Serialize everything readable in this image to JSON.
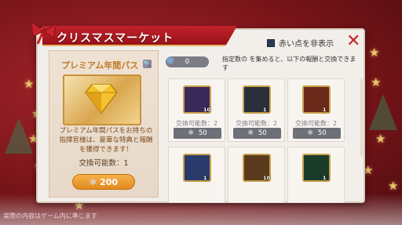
{
  "title": "クリスマスマーケット",
  "hide_red_dot_label": "赤い点を非表示",
  "close_label": "✕",
  "pass": {
    "title": "プレミアム年間パス",
    "description": "プレミアム年間パスをお持ちの指揮官様は、豪華な特典と報酬を獲得できます！",
    "count_label": "交換可能数：1",
    "price": "200"
  },
  "currency": {
    "value": "0"
  },
  "instruction": "指定数の を集めると、以下の報酬と交換できます",
  "items": [
    {
      "qty": "10",
      "count_label": "交換可能数：2",
      "price": "50",
      "color": "#3a2a5a"
    },
    {
      "qty": "1",
      "count_label": "交換可能数：2",
      "price": "50",
      "color": "#2a2f3a"
    },
    {
      "qty": "1",
      "count_label": "交換可能数：2",
      "price": "50",
      "color": "#6a2a1a"
    },
    {
      "qty": "1",
      "count_label": "",
      "price": "",
      "color": "#2a3a6a"
    },
    {
      "qty": "10",
      "count_label": "",
      "price": "",
      "color": "#5a3a1a"
    },
    {
      "qty": "1",
      "count_label": "",
      "price": "",
      "color": "#1a3a2a"
    }
  ],
  "footnote": "実際の内容はゲーム内に準じます"
}
